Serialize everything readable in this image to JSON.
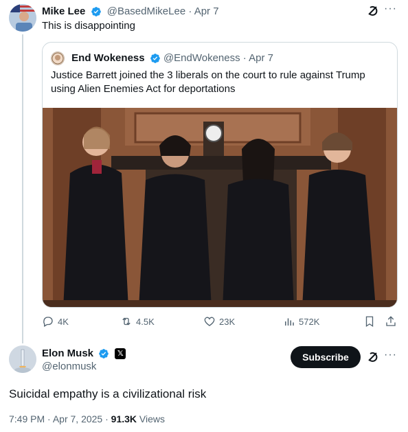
{
  "tweet": {
    "author_name": "Mike Lee",
    "author_handle": "@BasedMikeLee",
    "sep": "·",
    "date": "Apr 7",
    "text": "This is disappointing",
    "more_label": "···"
  },
  "quote": {
    "author_name": "End Wokeness",
    "author_handle": "@EndWokeness",
    "sep": "·",
    "date": "Apr 7",
    "text": "Justice Barrett joined the 3 liberals on the court to rule against Trump using Alien Enemies Act for deportations"
  },
  "actions": {
    "replies": "4K",
    "reposts": "4.5K",
    "likes": "23K",
    "views": "572K"
  },
  "reply": {
    "author_name": "Elon Musk",
    "author_handle": "@elonmusk",
    "badge": "𝕏",
    "subscribe_label": "Subscribe",
    "more_label": "···",
    "text": "Suicidal empathy is a civilizational risk",
    "time": "7:49 PM",
    "sep": "·",
    "date": "Apr 7, 2025",
    "sep2": "·",
    "views_count": "91.3K",
    "views_label": "Views"
  },
  "colors": {
    "verified": "#1d9bf0",
    "text": "#0f1419",
    "muted": "#536471",
    "border": "#cfd9de"
  },
  "icons": [
    "verified-badge-icon",
    "grok-icon",
    "reply-icon",
    "repost-icon",
    "like-icon",
    "views-icon",
    "bookmark-icon",
    "share-icon"
  ]
}
